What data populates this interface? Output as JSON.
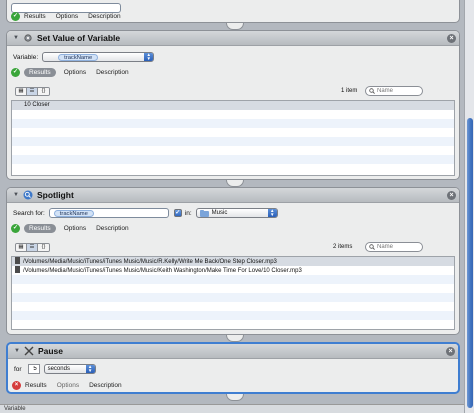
{
  "top_block": {
    "tabs": [
      {
        "label": "Results"
      },
      {
        "label": "Options"
      },
      {
        "label": "Description"
      }
    ]
  },
  "set_value_block": {
    "title": "Set Value of Variable",
    "variable_label": "Variable:",
    "variable_value": "trackName",
    "tabs": [
      {
        "label": "Results"
      },
      {
        "label": "Options"
      },
      {
        "label": "Description"
      }
    ],
    "item_count": "1 item",
    "search_placeholder": "Name",
    "view_buttons": [
      "list",
      "table",
      "{}"
    ],
    "results": [
      "10 Closer"
    ]
  },
  "spotlight_block": {
    "title": "Spotlight",
    "search_for_label": "Search for:",
    "search_for_value": "trackName",
    "in_label": "in:",
    "location_value": "Music",
    "tabs": [
      {
        "label": "Results"
      },
      {
        "label": "Options"
      },
      {
        "label": "Description"
      }
    ],
    "item_count": "2 items",
    "search_placeholder": "Name",
    "results": [
      "/Volumes/Media/Music/iTunes/iTunes Music/Music/R.Kelly/Write Me Back/One Step Closer.mp3",
      "/Volumes/Media/Music/iTunes/iTunes Music/Music/Keith Washington/Make Time For Love/10 Closer.mp3"
    ]
  },
  "pause_block": {
    "title": "Pause",
    "for_label": "for",
    "duration_value": "5",
    "unit_value": "seconds",
    "tabs": [
      {
        "label": "Results"
      },
      {
        "label": "Options"
      },
      {
        "label": "Description"
      }
    ]
  },
  "bottom": {
    "label": "Variable"
  },
  "colors": {
    "accent": "#3f7ed1",
    "ok": "#3aa53a",
    "error": "#d53c3c",
    "canvas": "#b3b8bf"
  },
  "icons": {
    "set_value": "gear-icon",
    "spotlight": "spotlight-icon",
    "pause": "pause-icon"
  }
}
